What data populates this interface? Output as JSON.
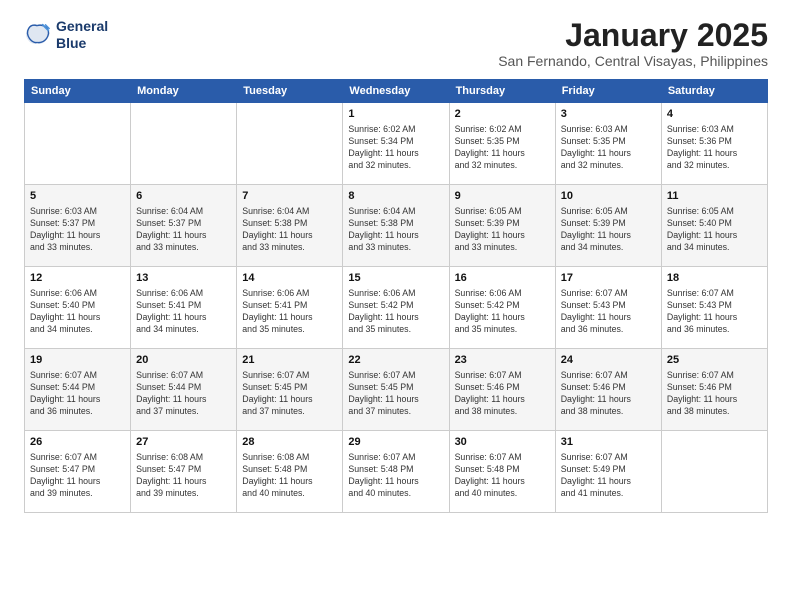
{
  "logo": {
    "line1": "General",
    "line2": "Blue"
  },
  "title": "January 2025",
  "subtitle": "San Fernando, Central Visayas, Philippines",
  "days_of_week": [
    "Sunday",
    "Monday",
    "Tuesday",
    "Wednesday",
    "Thursday",
    "Friday",
    "Saturday"
  ],
  "weeks": [
    [
      {
        "day": "",
        "info": ""
      },
      {
        "day": "",
        "info": ""
      },
      {
        "day": "",
        "info": ""
      },
      {
        "day": "1",
        "info": "Sunrise: 6:02 AM\nSunset: 5:34 PM\nDaylight: 11 hours\nand 32 minutes."
      },
      {
        "day": "2",
        "info": "Sunrise: 6:02 AM\nSunset: 5:35 PM\nDaylight: 11 hours\nand 32 minutes."
      },
      {
        "day": "3",
        "info": "Sunrise: 6:03 AM\nSunset: 5:35 PM\nDaylight: 11 hours\nand 32 minutes."
      },
      {
        "day": "4",
        "info": "Sunrise: 6:03 AM\nSunset: 5:36 PM\nDaylight: 11 hours\nand 32 minutes."
      }
    ],
    [
      {
        "day": "5",
        "info": "Sunrise: 6:03 AM\nSunset: 5:37 PM\nDaylight: 11 hours\nand 33 minutes."
      },
      {
        "day": "6",
        "info": "Sunrise: 6:04 AM\nSunset: 5:37 PM\nDaylight: 11 hours\nand 33 minutes."
      },
      {
        "day": "7",
        "info": "Sunrise: 6:04 AM\nSunset: 5:38 PM\nDaylight: 11 hours\nand 33 minutes."
      },
      {
        "day": "8",
        "info": "Sunrise: 6:04 AM\nSunset: 5:38 PM\nDaylight: 11 hours\nand 33 minutes."
      },
      {
        "day": "9",
        "info": "Sunrise: 6:05 AM\nSunset: 5:39 PM\nDaylight: 11 hours\nand 33 minutes."
      },
      {
        "day": "10",
        "info": "Sunrise: 6:05 AM\nSunset: 5:39 PM\nDaylight: 11 hours\nand 34 minutes."
      },
      {
        "day": "11",
        "info": "Sunrise: 6:05 AM\nSunset: 5:40 PM\nDaylight: 11 hours\nand 34 minutes."
      }
    ],
    [
      {
        "day": "12",
        "info": "Sunrise: 6:06 AM\nSunset: 5:40 PM\nDaylight: 11 hours\nand 34 minutes."
      },
      {
        "day": "13",
        "info": "Sunrise: 6:06 AM\nSunset: 5:41 PM\nDaylight: 11 hours\nand 34 minutes."
      },
      {
        "day": "14",
        "info": "Sunrise: 6:06 AM\nSunset: 5:41 PM\nDaylight: 11 hours\nand 35 minutes."
      },
      {
        "day": "15",
        "info": "Sunrise: 6:06 AM\nSunset: 5:42 PM\nDaylight: 11 hours\nand 35 minutes."
      },
      {
        "day": "16",
        "info": "Sunrise: 6:06 AM\nSunset: 5:42 PM\nDaylight: 11 hours\nand 35 minutes."
      },
      {
        "day": "17",
        "info": "Sunrise: 6:07 AM\nSunset: 5:43 PM\nDaylight: 11 hours\nand 36 minutes."
      },
      {
        "day": "18",
        "info": "Sunrise: 6:07 AM\nSunset: 5:43 PM\nDaylight: 11 hours\nand 36 minutes."
      }
    ],
    [
      {
        "day": "19",
        "info": "Sunrise: 6:07 AM\nSunset: 5:44 PM\nDaylight: 11 hours\nand 36 minutes."
      },
      {
        "day": "20",
        "info": "Sunrise: 6:07 AM\nSunset: 5:44 PM\nDaylight: 11 hours\nand 37 minutes."
      },
      {
        "day": "21",
        "info": "Sunrise: 6:07 AM\nSunset: 5:45 PM\nDaylight: 11 hours\nand 37 minutes."
      },
      {
        "day": "22",
        "info": "Sunrise: 6:07 AM\nSunset: 5:45 PM\nDaylight: 11 hours\nand 37 minutes."
      },
      {
        "day": "23",
        "info": "Sunrise: 6:07 AM\nSunset: 5:46 PM\nDaylight: 11 hours\nand 38 minutes."
      },
      {
        "day": "24",
        "info": "Sunrise: 6:07 AM\nSunset: 5:46 PM\nDaylight: 11 hours\nand 38 minutes."
      },
      {
        "day": "25",
        "info": "Sunrise: 6:07 AM\nSunset: 5:46 PM\nDaylight: 11 hours\nand 38 minutes."
      }
    ],
    [
      {
        "day": "26",
        "info": "Sunrise: 6:07 AM\nSunset: 5:47 PM\nDaylight: 11 hours\nand 39 minutes."
      },
      {
        "day": "27",
        "info": "Sunrise: 6:08 AM\nSunset: 5:47 PM\nDaylight: 11 hours\nand 39 minutes."
      },
      {
        "day": "28",
        "info": "Sunrise: 6:08 AM\nSunset: 5:48 PM\nDaylight: 11 hours\nand 40 minutes."
      },
      {
        "day": "29",
        "info": "Sunrise: 6:07 AM\nSunset: 5:48 PM\nDaylight: 11 hours\nand 40 minutes."
      },
      {
        "day": "30",
        "info": "Sunrise: 6:07 AM\nSunset: 5:48 PM\nDaylight: 11 hours\nand 40 minutes."
      },
      {
        "day": "31",
        "info": "Sunrise: 6:07 AM\nSunset: 5:49 PM\nDaylight: 11 hours\nand 41 minutes."
      },
      {
        "day": "",
        "info": ""
      }
    ]
  ]
}
